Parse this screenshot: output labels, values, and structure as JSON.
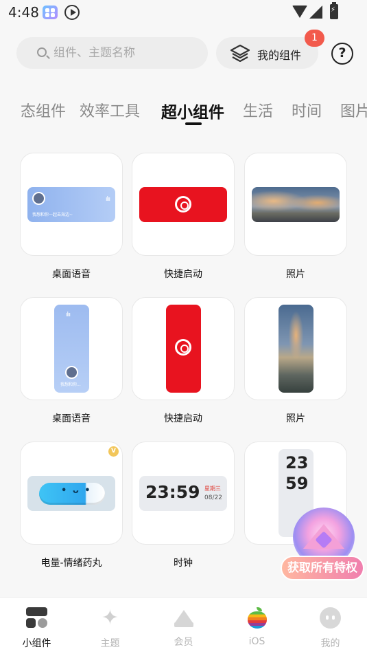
{
  "status_bar": {
    "time": "4:48"
  },
  "header": {
    "search_placeholder": "组件、主题名称",
    "my_widgets_label": "我的组件",
    "my_widgets_badge": "1",
    "help_symbol": "?"
  },
  "tabs": [
    {
      "label": "态组件",
      "active": false
    },
    {
      "label": "效率工具",
      "active": false
    },
    {
      "label": "超小组件",
      "active": true
    },
    {
      "label": "生活",
      "active": false
    },
    {
      "label": "时间",
      "active": false
    },
    {
      "label": "图片",
      "active": false
    }
  ],
  "widgets": [
    {
      "caption": "桌面语音",
      "preview_text": "我想和你一起去海边~"
    },
    {
      "caption": "快捷启动"
    },
    {
      "caption": "照片"
    },
    {
      "caption": "桌面语音",
      "preview_text": "我想和你..."
    },
    {
      "caption": "快捷启动"
    },
    {
      "caption": "照片"
    },
    {
      "caption": "电量-情绪药丸",
      "face": "• ᴗ •",
      "vip_mark": "V"
    },
    {
      "caption": "时钟",
      "time": "23:59",
      "weekday": "星期三",
      "date": "08/22"
    },
    {
      "caption": "",
      "hours": "23",
      "minutes": "59"
    }
  ],
  "promo": {
    "label": "获取所有特权"
  },
  "bottom_nav": [
    {
      "label": "小组件",
      "icon": "widget-grid-icon",
      "active": true
    },
    {
      "label": "主题",
      "icon": "sparkle-icon",
      "active": false
    },
    {
      "label": "会员",
      "icon": "crown-icon",
      "active": false
    },
    {
      "label": "iOS",
      "icon": "apple-icon",
      "active": false
    },
    {
      "label": "我的",
      "icon": "profile-face-icon",
      "active": false
    }
  ],
  "colors": {
    "accent_red": "#e8131f",
    "badge_red": "#f25a4c",
    "voice_blue": "#9dbbf0",
    "pill_blue": "#2fa7ee"
  }
}
